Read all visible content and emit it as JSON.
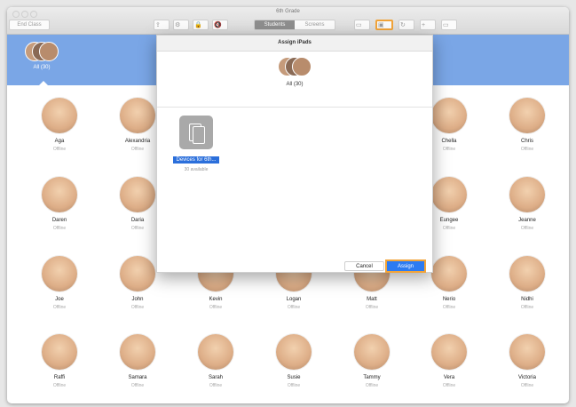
{
  "window": {
    "title": "6th Grade"
  },
  "toolbar": {
    "end_class_label": "End Class",
    "segments": [
      "Students",
      "Screens"
    ],
    "selected_segment": "Students",
    "icons": [
      "share-icon",
      "settings-icon",
      "lock-icon",
      "mute-icon",
      "airplay-icon",
      "assign-ipads-icon",
      "refresh-icon",
      "add-icon",
      "monitor-icon"
    ],
    "highlight_color": "#f1a43a"
  },
  "header": {
    "group_label": "All (30)",
    "background": "#7aa6e6"
  },
  "students": [
    {
      "name": "Aga",
      "status": "Offline"
    },
    {
      "name": "Alexandria",
      "status": "Offline"
    },
    {
      "name": "Chella",
      "status": "Offline"
    },
    {
      "name": "Chris",
      "status": "Offline"
    },
    {
      "name": "Daren",
      "status": "Offline"
    },
    {
      "name": "Daria",
      "status": "Offline"
    },
    {
      "name": "Eungee",
      "status": "Offline"
    },
    {
      "name": "Jeanne",
      "status": "Offline"
    },
    {
      "name": "Joe",
      "status": "Offline"
    },
    {
      "name": "John",
      "status": "Offline"
    },
    {
      "name": "Kevin",
      "status": "Offline"
    },
    {
      "name": "Logan",
      "status": "Offline"
    },
    {
      "name": "Matt",
      "status": "Offline"
    },
    {
      "name": "Nerio",
      "status": "Offline"
    },
    {
      "name": "Nidhi",
      "status": "Offline"
    },
    {
      "name": "Raffi",
      "status": "Offline"
    },
    {
      "name": "Samara",
      "status": "Offline"
    },
    {
      "name": "Sarah",
      "status": "Offline"
    },
    {
      "name": "Susie",
      "status": "Offline"
    },
    {
      "name": "Tammy",
      "status": "Offline"
    },
    {
      "name": "Vera",
      "status": "Offline"
    },
    {
      "name": "Victoria",
      "status": "Offline"
    }
  ],
  "dialog": {
    "title": "Assign iPads",
    "group_label": "All (30)",
    "device_group": {
      "label": "Devices for 6th...",
      "count": "30 available"
    },
    "cancel_label": "Cancel",
    "assign_label": "Assign"
  },
  "colors": {
    "accent": "#2c7bf2",
    "highlight": "#f1a43a",
    "header": "#7aa6e6"
  }
}
